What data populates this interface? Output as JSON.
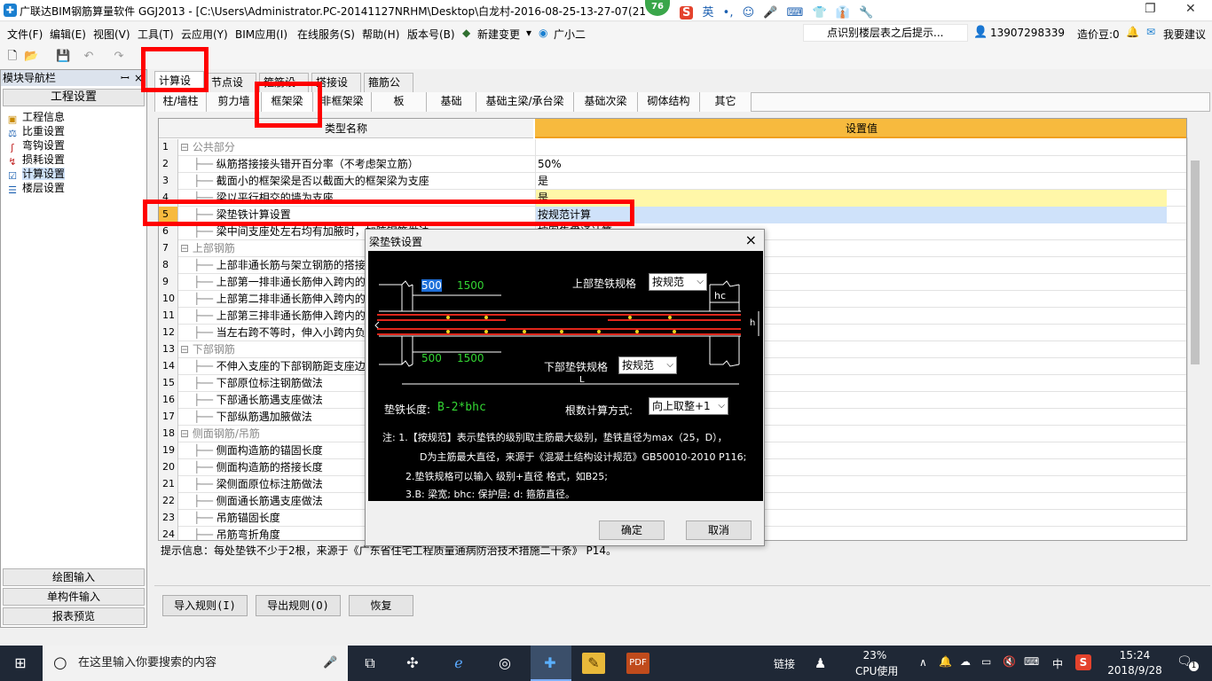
{
  "window": {
    "title": "广联达BIM钢筋算量软件 GGJ2013 - [C:\\Users\\Administrator.PC-20141127NRHM\\Desktop\\白龙村-2016-08-25-13-27-07(21",
    "badge": "76",
    "ime": [
      "英",
      "•,",
      "☺",
      "🎤",
      "⌨",
      "👕",
      "👔",
      "🔧"
    ]
  },
  "menu": {
    "items": [
      "文件(F)",
      "编辑(E)",
      "视图(V)",
      "工具(T)",
      "云应用(Y)",
      "BIM应用(I)",
      "在线服务(S)",
      "帮助(H)",
      "版本号(B)",
      "新建变更",
      "广小二"
    ],
    "new_change_dropdown": "▾",
    "hint": "点识别楼层表之后提示...",
    "phone": "13907298339",
    "coins": "造价豆:0",
    "suggest": "我要建议"
  },
  "left_panel": {
    "header": "模块导航栏",
    "pin": "ꟷ",
    "close": "×",
    "title": "工程设置",
    "items": [
      "工程信息",
      "比重设置",
      "弯钩设置",
      "损耗设置",
      "计算设置",
      "楼层设置"
    ],
    "bottom": [
      "绘图输入",
      "单构件输入",
      "报表预览"
    ]
  },
  "tabs_top": [
    "计算设置",
    "节点设置",
    "箍筋设置",
    "搭接设置",
    "箍筋公式"
  ],
  "tabs_sub": [
    "柱/墙柱",
    "剪力墙",
    "框架梁",
    "非框架梁",
    "板",
    "基础",
    "基础主梁/承台梁",
    "基础次梁",
    "砌体结构",
    "其它"
  ],
  "grid": {
    "headers": [
      "类型名称",
      "设置值"
    ],
    "rows": [
      {
        "n": "1",
        "name": "公共部分",
        "value": "",
        "group": true
      },
      {
        "n": "2",
        "name": "纵筋搭接接头错开百分率（不考虑架立筋）",
        "value": "50%"
      },
      {
        "n": "3",
        "name": "截面小的框架梁是否以截面大的框架梁为支座",
        "value": "是"
      },
      {
        "n": "4",
        "name": "梁以平行相交的墙为支座",
        "value": "是"
      },
      {
        "n": "5",
        "name": "梁垫铁计算设置",
        "value": "按规范计算"
      },
      {
        "n": "6",
        "name": "梁中间支座处左右均有加腋时，加腋钢筋做法",
        "value": "按图集贯通计算"
      },
      {
        "n": "7",
        "name": "上部钢筋",
        "value": "",
        "group": true
      },
      {
        "n": "8",
        "name": "上部非通长筋与架立钢筋的搭接长",
        "value": ""
      },
      {
        "n": "9",
        "name": "上部第一排非通长筋伸入跨内的长",
        "value": ""
      },
      {
        "n": "10",
        "name": "上部第二排非通长筋伸入跨内的长",
        "value": ""
      },
      {
        "n": "11",
        "name": "上部第三排非通长筋伸入跨内的长",
        "value": ""
      },
      {
        "n": "12",
        "name": "当左右跨不等时，伸入小跨内负筋",
        "value": ""
      },
      {
        "n": "13",
        "name": "下部钢筋",
        "value": "",
        "group": true
      },
      {
        "n": "14",
        "name": "不伸入支座的下部钢筋距支座边的",
        "value": ""
      },
      {
        "n": "15",
        "name": "下部原位标注钢筋做法",
        "value": ""
      },
      {
        "n": "16",
        "name": "下部通长筋遇支座做法",
        "value": ""
      },
      {
        "n": "17",
        "name": "下部纵筋遇加腋做法",
        "value": ""
      },
      {
        "n": "18",
        "name": "侧面钢筋/吊筋",
        "value": "",
        "group": true
      },
      {
        "n": "19",
        "name": "侧面构造筋的锚固长度",
        "value": ""
      },
      {
        "n": "20",
        "name": "侧面构造筋的搭接长度",
        "value": ""
      },
      {
        "n": "21",
        "name": "梁侧面原位标注筋做法",
        "value": ""
      },
      {
        "n": "22",
        "name": "侧面通长筋遇支座做法",
        "value": ""
      },
      {
        "n": "23",
        "name": "吊筋锚固长度",
        "value": ""
      },
      {
        "n": "24",
        "name": "吊筋弯折角度",
        "value": ""
      }
    ]
  },
  "hint_text": "提示信息：每处垫铁不少于2根，来源于《广东省住宅工程质量通病防治技术措施二十条》 P14。",
  "bottom_buttons": [
    "导入规则(I)",
    "导出规则(O)",
    "恢复"
  ],
  "dialog": {
    "title": "梁垫铁设置",
    "close": "×",
    "top_spec_label": "上部垫铁规格",
    "top_spec_value": "按规范",
    "bottom_spec_label": "下部垫铁规格",
    "bottom_spec_value": "按规范",
    "length_label": "垫铁长度:",
    "length_value": "B-2*bhc",
    "count_label": "根数计算方式:",
    "count_value": "向上取整+1",
    "dim_500": "500",
    "dim_1500": "1500",
    "dim_hc": "hc",
    "dim_L": "L",
    "dim_h": "h",
    "notes": [
      "注: 1.【按规范】表示垫铁的级别取主筋最大级别，垫铁直径为max（25，D），",
      "D为主筋最大直径，来源于《混凝土结构设计规范》GB50010-2010 P116;",
      "2.垫铁规格可以输入 级别+直径 格式，如B25;",
      "3.B: 梁宽; bhc: 保护层; d: 箍筋直径。"
    ],
    "ok": "确定",
    "cancel": "取消"
  },
  "taskbar": {
    "search": "在这里输入你要搜索的内容",
    "link": "链接",
    "cpu_pct": "23%",
    "cpu_label": "CPU使用",
    "ime": "中",
    "time": "15:24",
    "date": "2018/9/28",
    "notify": "1"
  },
  "colors": {
    "accent_header": "#f7ba3e",
    "red_annotation": "#ff0000",
    "rebar": "#e0261b",
    "dim_green": "#33d633",
    "dim_blue": "#1e6fd9"
  }
}
